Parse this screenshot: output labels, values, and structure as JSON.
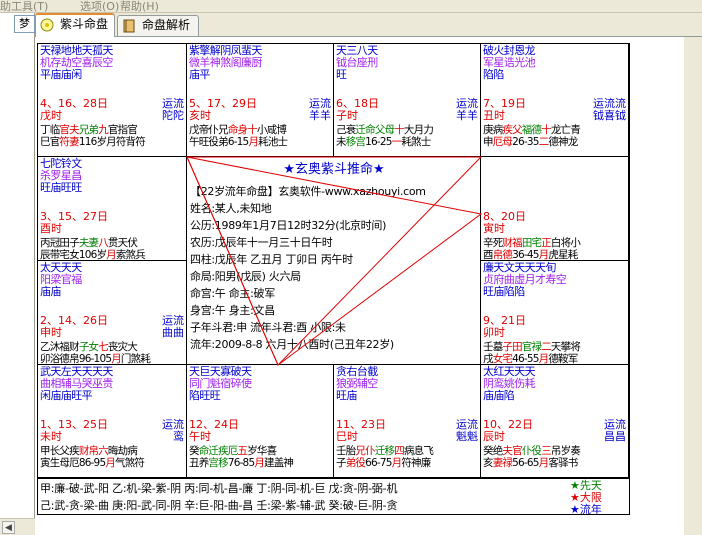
{
  "menu": {
    "tools": "助工具",
    "tools_key": "(T)",
    "options": "选项",
    "options_key": "(O)",
    "help": "帮助",
    "help_key": "(H)"
  },
  "left_pane": {
    "label": "梦"
  },
  "tabs": [
    {
      "label": "紫斗命盘",
      "active": true,
      "icon": "yellow-circle-icon"
    },
    {
      "label": "命盘解析",
      "active": false,
      "icon": "notebook-icon"
    }
  ],
  "colors": {
    "blue": "#0000cc",
    "purple": "#a020f0",
    "red": "#e00000",
    "green": "#008000",
    "line": "#e00000"
  },
  "palaces": [
    {
      "id": "si",
      "l1": "天禄地地天孤天",
      "l2": "机存劫空喜辰空",
      "l3": "平庙庙闲",
      "ages": "4、16、28日",
      "liu": "运流",
      "gz": "戊时",
      "luck": "陀陀",
      "r1": [
        [
          "丁临",
          "d"
        ],
        [
          "官夫",
          "s"
        ],
        [
          "兄弟",
          "p"
        ],
        [
          "九",
          "s"
        ],
        [
          "官指官",
          "d"
        ]
      ],
      "r2": [
        [
          "巳官",
          "d"
        ],
        [
          "符",
          "s"
        ],
        [
          "妻",
          "s"
        ],
        [
          "116岁",
          "d"
        ],
        [
          "月符背符",
          "d"
        ]
      ]
    },
    {
      "id": "wu",
      "l1": "紫擎解阴凤蜚天",
      "l2": "微羊神煞阁廉厨",
      "l3": "庙平",
      "ages": "5、17、29日",
      "liu": "运流",
      "gz": "亥时",
      "luck": "羊羊",
      "r1": [
        [
          "戊帝仆兄",
          "d"
        ],
        [
          "命身",
          "s"
        ],
        [
          "十",
          "s"
        ],
        [
          "小咸博",
          "d"
        ]
      ],
      "r2": [
        [
          "午旺役弟",
          "d"
        ],
        [
          "6-15",
          "d"
        ],
        [
          "月",
          "s"
        ],
        [
          "耗池士",
          "d"
        ]
      ]
    },
    {
      "id": "wei",
      "l1": "天三八天",
      "l2": "钺台座刑",
      "l3": "旺",
      "ages": "6、18日",
      "liu": "运流",
      "gz": "子时",
      "luck": "羊羊",
      "r1": [
        [
          "己衰",
          "d"
        ],
        [
          "迁命",
          "p"
        ],
        [
          "父母",
          "p"
        ],
        [
          "十",
          "s"
        ],
        [
          "大月力",
          "d"
        ]
      ],
      "r2": [
        [
          "未",
          "d"
        ],
        [
          "移宫",
          "p"
        ],
        [
          "16-25",
          "d"
        ],
        [
          "一",
          "s"
        ],
        [
          "耗煞士",
          "d"
        ]
      ]
    },
    {
      "id": "shen",
      "l1": "破火封恩龙",
      "l2": "军星诰光池",
      "l3": "陷陷",
      "ages": "7、19日",
      "liu": "运流流",
      "gz": "丑时",
      "luck": "钺喜钺",
      "r1": [
        [
          "庚病",
          "d"
        ],
        [
          "疾父",
          "s"
        ],
        [
          "福德",
          "p"
        ],
        [
          "十",
          "s"
        ],
        [
          "龙亡青",
          "d"
        ]
      ],
      "r2": [
        [
          "申",
          "d"
        ],
        [
          "厄母",
          "s"
        ],
        [
          "26-35",
          "d"
        ],
        [
          "二",
          "s"
        ],
        [
          "德神龙",
          "d"
        ]
      ]
    },
    {
      "id": "chen",
      "l1": "七陀铃文",
      "l2": "杀罗星昌",
      "l3": "旺庙旺旺",
      "ages": "3、15、27日",
      "liu": "",
      "gz": "酉时",
      "luck": "",
      "r1": [
        [
          "丙冠田子",
          "d"
        ],
        [
          "夫妻",
          "p"
        ],
        [
          "八",
          "s"
        ],
        [
          "贯天伏",
          "d"
        ]
      ],
      "r2": [
        [
          "辰带宅女",
          "d"
        ],
        [
          "106岁",
          "d"
        ],
        [
          "月",
          "s"
        ],
        [
          "索煞兵",
          "d"
        ]
      ]
    },
    {
      "id": "you",
      "l1": "",
      "l2": "",
      "l3": "",
      "ages": "8、20日",
      "liu": "",
      "gz": "寅时",
      "luck": "",
      "r1": [
        [
          "辛死",
          "d"
        ],
        [
          "财福",
          "s"
        ],
        [
          "田宅",
          "p"
        ],
        [
          "正",
          "s"
        ],
        [
          "白将小",
          "d"
        ]
      ],
      "r2": [
        [
          "酉",
          "d"
        ],
        [
          "帛德",
          "s"
        ],
        [
          "36-45",
          "d"
        ],
        [
          "月",
          "s"
        ],
        [
          "虎星耗",
          "d"
        ]
      ]
    },
    {
      "id": "mao",
      "l1": "太天天天",
      "l2": "阳梁官福",
      "l3": "庙庙",
      "ages": "2、14、26日",
      "liu": "运流",
      "gz": "申时",
      "luck": "曲曲",
      "r1": [
        [
          "乙沐福财",
          "d"
        ],
        [
          "子女",
          "p"
        ],
        [
          "七",
          "s"
        ],
        [
          "丧灾大",
          "d"
        ]
      ],
      "r2": [
        [
          "卯浴德帛",
          "d"
        ],
        [
          "96-105",
          "d"
        ],
        [
          "月",
          "s"
        ],
        [
          "门煞耗",
          "d"
        ]
      ]
    },
    {
      "id": "xu",
      "l1": "廉天文天天天旬",
      "l2": "贞府曲虚月才寿空",
      "l3": "旺庙陷陷",
      "ages": "9、21日",
      "liu": "",
      "gz": "卯时",
      "luck": "",
      "r1": [
        [
          "壬墓",
          "d"
        ],
        [
          "子田",
          "s"
        ],
        [
          "官禄",
          "p"
        ],
        [
          "二",
          "s"
        ],
        [
          "天攀将",
          "d"
        ]
      ],
      "r2": [
        [
          "戌",
          "d"
        ],
        [
          "女宅",
          "s"
        ],
        [
          "46-55",
          "d"
        ],
        [
          "月",
          "s"
        ],
        [
          "德鞍军",
          "d"
        ]
      ]
    },
    {
      "id": "yin",
      "l1": "武天左天天天天",
      "l2": "曲相辅马哭巫贵",
      "l3": "闲庙庙旺平",
      "ages": "1、13、25日",
      "liu": "运流",
      "gz": "未时",
      "luck": "鸾",
      "r1": [
        [
          "甲长父疾",
          "d"
        ],
        [
          "财帛",
          "s"
        ],
        [
          "六",
          "s"
        ],
        [
          "晦劫病",
          "d"
        ]
      ],
      "r2": [
        [
          "寅生母厄",
          "d"
        ],
        [
          "86-95",
          "d"
        ],
        [
          "月",
          "s"
        ],
        [
          "气煞符",
          "d"
        ]
      ]
    },
    {
      "id": "chou",
      "l1": "天巨天寡破天",
      "l2": "同门魁宿碎使",
      "l3": "陷旺旺",
      "ages": "12、24日",
      "liu": "",
      "gz": "午时",
      "luck": "",
      "r1": [
        [
          "癸",
          "d"
        ],
        [
          "命迁",
          "p"
        ],
        [
          "疾厄",
          "p"
        ],
        [
          "五",
          "s"
        ],
        [
          "岁华喜",
          "d"
        ]
      ],
      "r2": [
        [
          "丑养",
          "d"
        ],
        [
          "宫移",
          "p"
        ],
        [
          "76-85",
          "d"
        ],
        [
          "月",
          "s"
        ],
        [
          "建盖神",
          "d"
        ]
      ]
    },
    {
      "id": "zi",
      "l1": "贪右台截",
      "l2": "狼弼辅空",
      "l3": "旺庙",
      "ages": "11、23日",
      "liu": "运流",
      "gz": "巳时",
      "luck": "魁魁",
      "r1": [
        [
          "壬胎",
          "d"
        ],
        [
          "兄仆",
          "s"
        ],
        [
          "迁移",
          "p"
        ],
        [
          "四",
          "s"
        ],
        [
          "病息飞",
          "d"
        ]
      ],
      "r2": [
        [
          "子",
          "d"
        ],
        [
          "弟役",
          "s"
        ],
        [
          "66-75",
          "d"
        ],
        [
          "月",
          "s"
        ],
        [
          "符神廉",
          "d"
        ]
      ]
    },
    {
      "id": "hai",
      "l1": "太红天天天",
      "l2": "阴鸾姚伤耗",
      "l3": "庙庙陷",
      "ages": "10、22日",
      "liu": "运流",
      "gz": "辰时",
      "luck": "昌昌",
      "r1": [
        [
          "癸绝",
          "d"
        ],
        [
          "夫官",
          "s"
        ],
        [
          "仆役",
          "p"
        ],
        [
          "三",
          "s"
        ],
        [
          "吊岁奏",
          "d"
        ]
      ],
      "r2": [
        [
          "亥",
          "d"
        ],
        [
          "妻禄",
          "s"
        ],
        [
          "56-65",
          "d"
        ],
        [
          "月",
          "s"
        ],
        [
          "客驿书",
          "d"
        ]
      ]
    }
  ],
  "center": {
    "title": "玄奥紫斗推命",
    "lines": [
      "【22岁流年命盘】玄奥软件-www.xazhouyi.com",
      "姓名:某人,未知地",
      "公历:1989年1月7日12时32分(北京时间)",
      "农历:戊辰年十一月三十日午时",
      "四柱:戊辰年 乙丑月 丁卯日 丙午时",
      "命局:阳男(戊辰)   火六局",
      "命宫:午        命主:破军",
      "身宫:午        身主:文昌",
      "子年斗君:申   流年斗君:酉   小限:未",
      "流年:2009-8-8 六月十八酉时(己丑年22岁)"
    ]
  },
  "sihua": [
    "甲:廉-破-武-阳    乙:机-梁-紫-阴    丙:同-机-昌-廉    丁:阴-同-机-巨    戊:贪-阴-弼-机",
    "己:武-贪-梁-曲    庚:阳-武-同-阴    辛:巨-阳-曲-昌    壬:梁-紫-辅-武    癸:破-巨-阴-贪"
  ],
  "legend": [
    {
      "label": "先天",
      "color": "#008000"
    },
    {
      "label": "大限",
      "color": "#e00000"
    },
    {
      "label": "流年",
      "color": "#0000cc"
    }
  ]
}
